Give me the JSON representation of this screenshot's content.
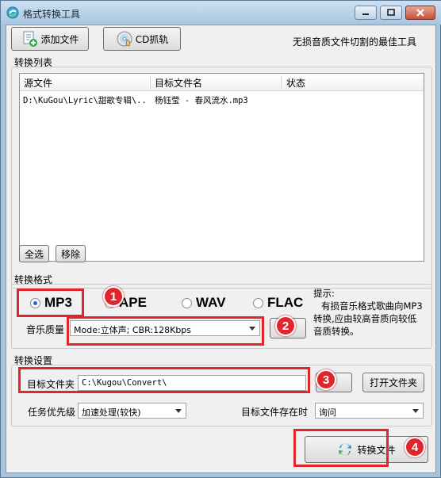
{
  "window": {
    "title": "格式转换工具"
  },
  "toolbar": {
    "add_file_label": "添加文件",
    "cd_grab_label": "CD抓轨",
    "slogan": "无损音质文件切割的最佳工具"
  },
  "convert_list": {
    "group_label": "转换列表",
    "columns": [
      "源文件",
      "目标文件名",
      "状态"
    ],
    "rows": [
      {
        "source": "D:\\KuGou\\Lyric\\甜歌专辑\\..",
        "target": "杨钰莹 - 春风流水.mp3",
        "status": ""
      }
    ],
    "select_all_label": "全选",
    "remove_label": "移除"
  },
  "format": {
    "group_label": "转换格式",
    "options": [
      "MP3",
      "APE",
      "WAV",
      "FLAC"
    ],
    "selected": "MP3",
    "quality_label": "音乐质量",
    "quality_value": "Mode:立体声; CBR:128Kbps",
    "tip_title": "提示:",
    "tip_lines": [
      "有损音乐格式歌曲向MP3",
      "转换,应由较高音质向较低",
      "音质转换。"
    ]
  },
  "settings": {
    "group_label": "转换设置",
    "target_folder_label": "目标文件夹",
    "target_folder_value": "C:\\Kugou\\Convert\\",
    "open_folder_label": "打开文件夹",
    "priority_label": "任务优先级",
    "priority_value": "加速处理(较快)",
    "exists_label": "目标文件存在时",
    "exists_value": "询问"
  },
  "actions": {
    "convert_label": "转换文件"
  },
  "annotations": {
    "badges": [
      "1",
      "2",
      "3",
      "4"
    ],
    "color": "#e0262b"
  }
}
